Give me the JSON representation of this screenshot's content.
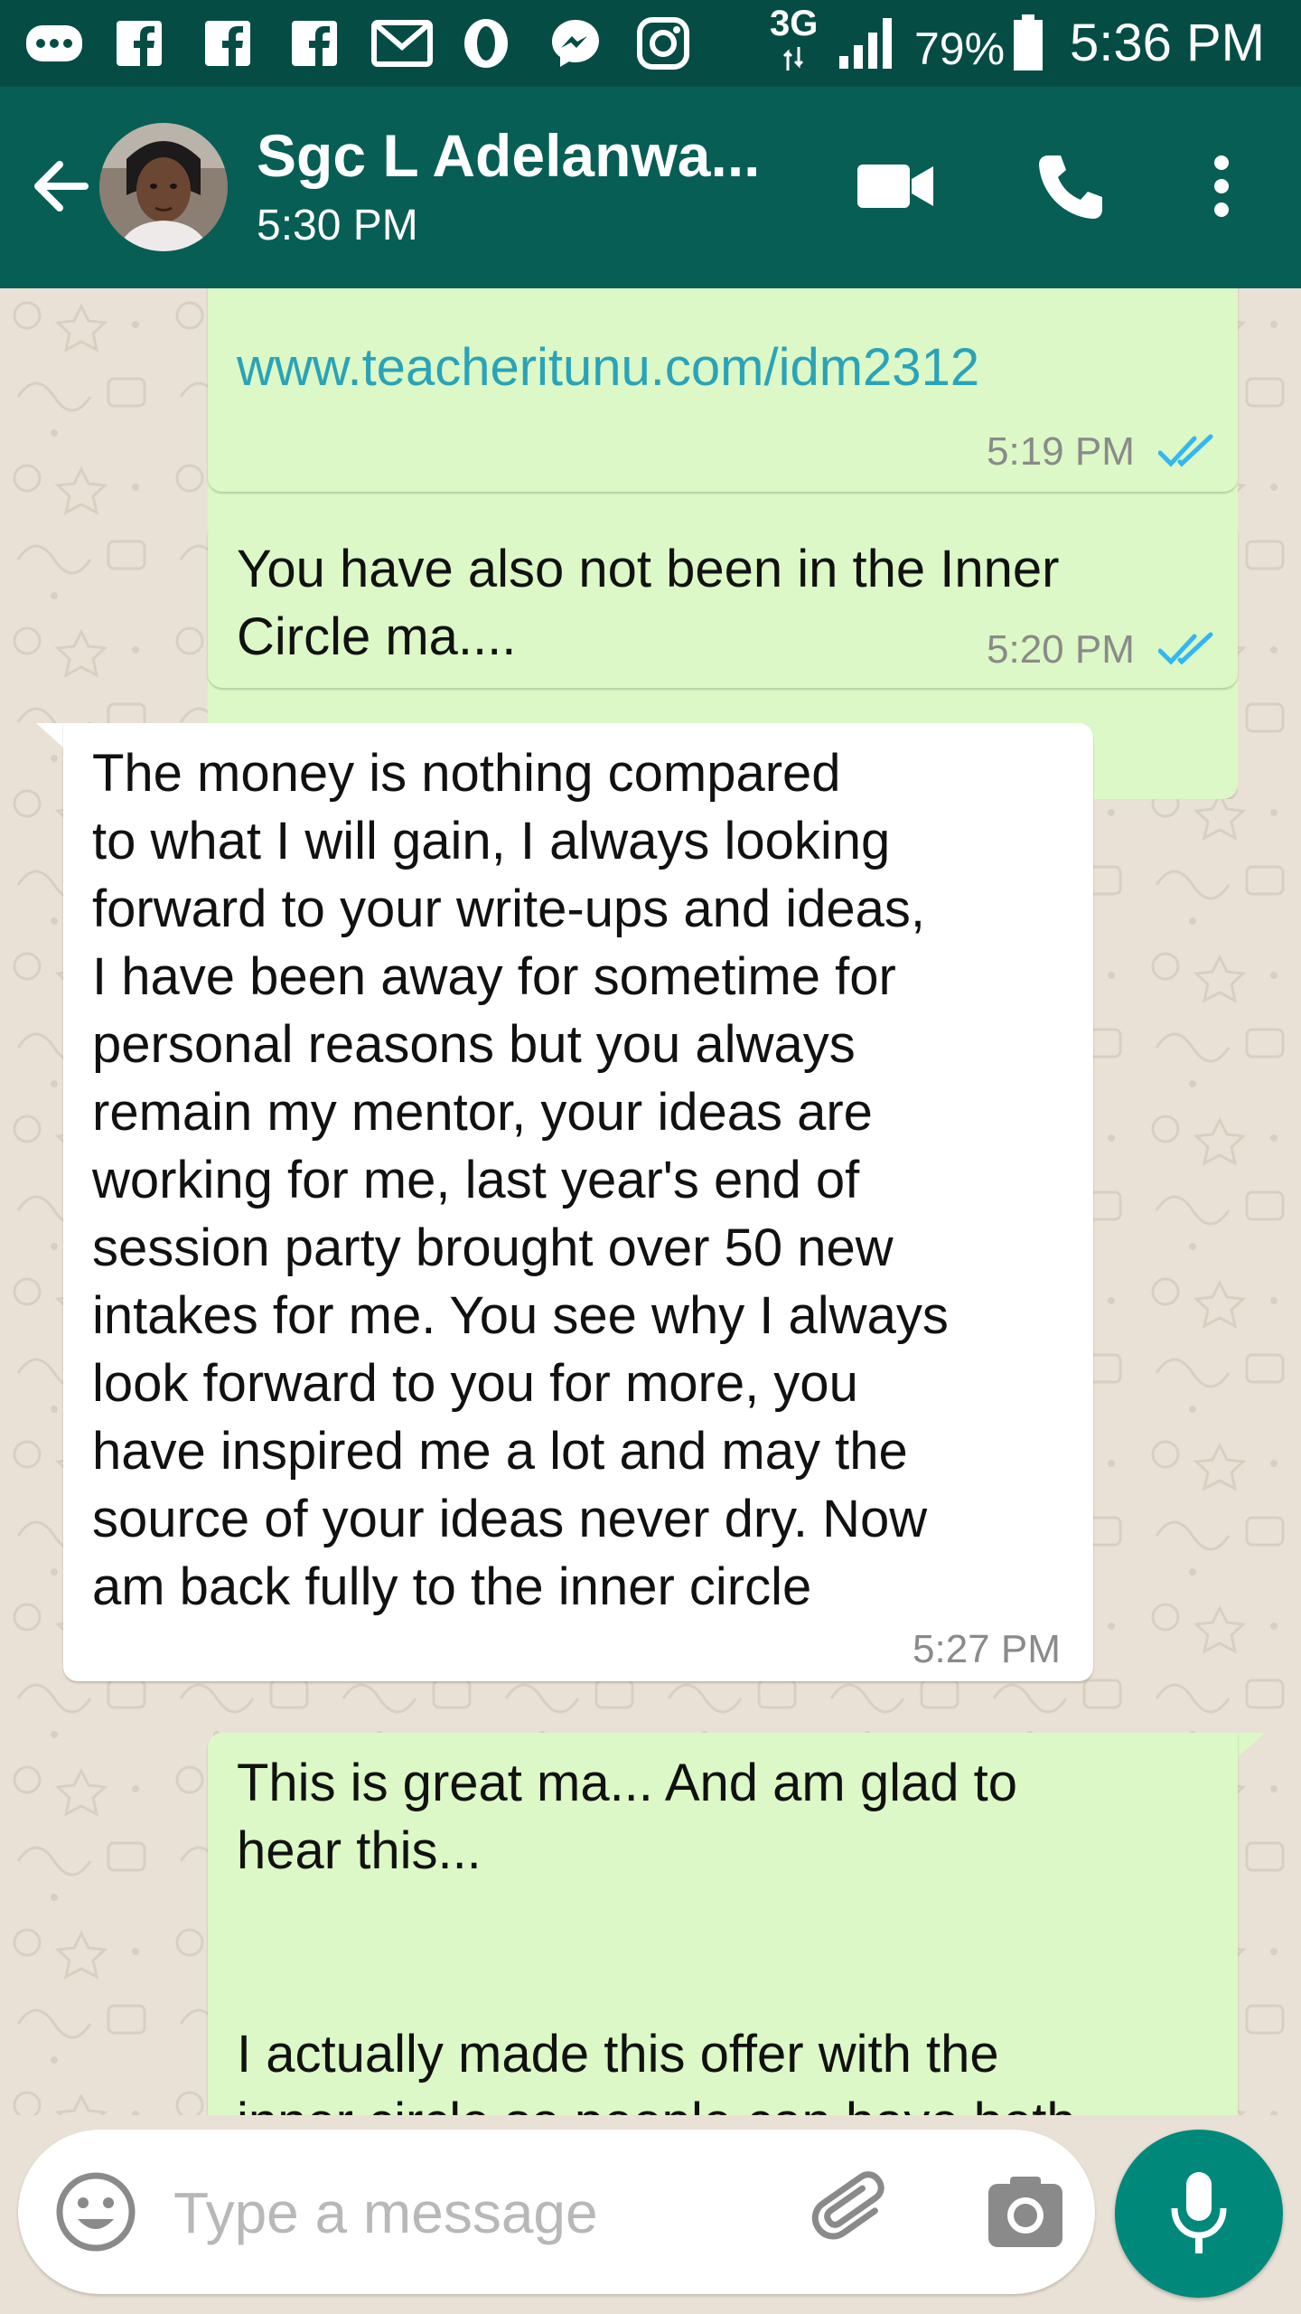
{
  "status_bar": {
    "network": "3G",
    "battery": "79%",
    "time": "5:36 PM",
    "icons": [
      "messages-icon",
      "facebook-icon",
      "facebook-icon",
      "facebook-icon",
      "gmail-icon",
      "opera-icon",
      "messenger-icon",
      "instagram-icon",
      "signal-icon",
      "battery-icon"
    ]
  },
  "header": {
    "contact_name": "Sgc L Adelanwa...",
    "last_seen": "5:30 PM",
    "icons": [
      "back-arrow-icon",
      "video-call-icon",
      "phone-icon",
      "more-vert-icon"
    ]
  },
  "messages": [
    {
      "direction": "out",
      "text": "www.teacheritunu.com/idm2312",
      "is_link": true,
      "time": "5:19 PM",
      "status": "read"
    },
    {
      "direction": "out",
      "text": "You have also not been in the Inner\nCircle ma....",
      "time": "5:20 PM",
      "status": "read"
    },
    {
      "direction": "in",
      "text": "The money is nothing compared\nto what I will gain, I always looking\nforward to your write-ups and ideas,\nI have been away for sometime for\npersonal reasons but you always\nremain my mentor, your ideas are\nworking for me, last year's end of\nsession party brought over 50 new\nintakes for me. You see why I always\nlook forward to you for more, you\nhave inspired me a lot and may the\nsource of your ideas never dry. Now\nam back fully to the inner circle",
      "time": "5:27 PM"
    },
    {
      "direction": "out",
      "text": "This is great ma... And am glad to\nhear this...\n\n\nI actually made this offer with the\ninner circle so people can have both"
    }
  ],
  "input": {
    "placeholder": "Type a message",
    "value": ""
  },
  "colors": {
    "status_bar": "#054d44",
    "header": "#075e54",
    "outgoing_bubble": "#dcf8c6",
    "incoming_bubble": "#ffffff",
    "chat_background": "#e9e1d6",
    "link": "#2aa3b8",
    "read_ticks": "#34b7f1",
    "mic_button": "#00897b"
  }
}
